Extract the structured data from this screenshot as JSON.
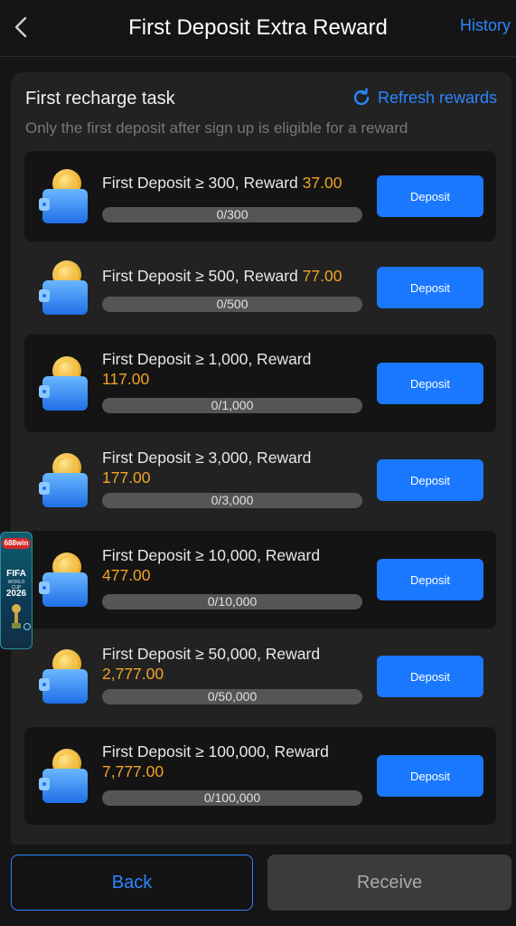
{
  "header": {
    "title": "First Deposit Extra Reward",
    "history_label": "History"
  },
  "panel": {
    "title": "First recharge task",
    "refresh_label": "Refresh rewards",
    "subtitle": "Only the first deposit after sign up is eligible for a reward"
  },
  "tasks": [
    {
      "label": "First Deposit ≥ 300, Reward",
      "reward": "37.00",
      "progress_text": "0/300",
      "progress": 0,
      "button": "Deposit"
    },
    {
      "label": "First Deposit ≥ 500, Reward",
      "reward": "77.00",
      "progress_text": "0/500",
      "progress": 0,
      "button": "Deposit"
    },
    {
      "label": "First Deposit ≥ 1,000, Reward",
      "reward": "117.00",
      "progress_text": "0/1,000",
      "progress": 0,
      "button": "Deposit"
    },
    {
      "label": "First Deposit ≥ 3,000, Reward",
      "reward": "177.00",
      "progress_text": "0/3,000",
      "progress": 0,
      "button": "Deposit"
    },
    {
      "label": "First Deposit ≥ 10,000, Reward",
      "reward": "477.00",
      "progress_text": "0/10,000",
      "progress": 0,
      "button": "Deposit"
    },
    {
      "label": "First Deposit ≥ 50,000, Reward",
      "reward": "2,777.00",
      "progress_text": "0/50,000",
      "progress": 0,
      "button": "Deposit"
    },
    {
      "label": "First Deposit ≥ 100,000, Reward",
      "reward": "7,777.00",
      "progress_text": "0/100,000",
      "progress": 0,
      "button": "Deposit"
    }
  ],
  "badge": {
    "brand": "688win",
    "line1": "FIFA",
    "line2": "WORLD CUP",
    "line3": "2026"
  },
  "footer": {
    "back_label": "Back",
    "receive_label": "Receive"
  },
  "colors": {
    "accent": "#1a78ff",
    "reward": "#f2a326",
    "background": "#151515"
  }
}
